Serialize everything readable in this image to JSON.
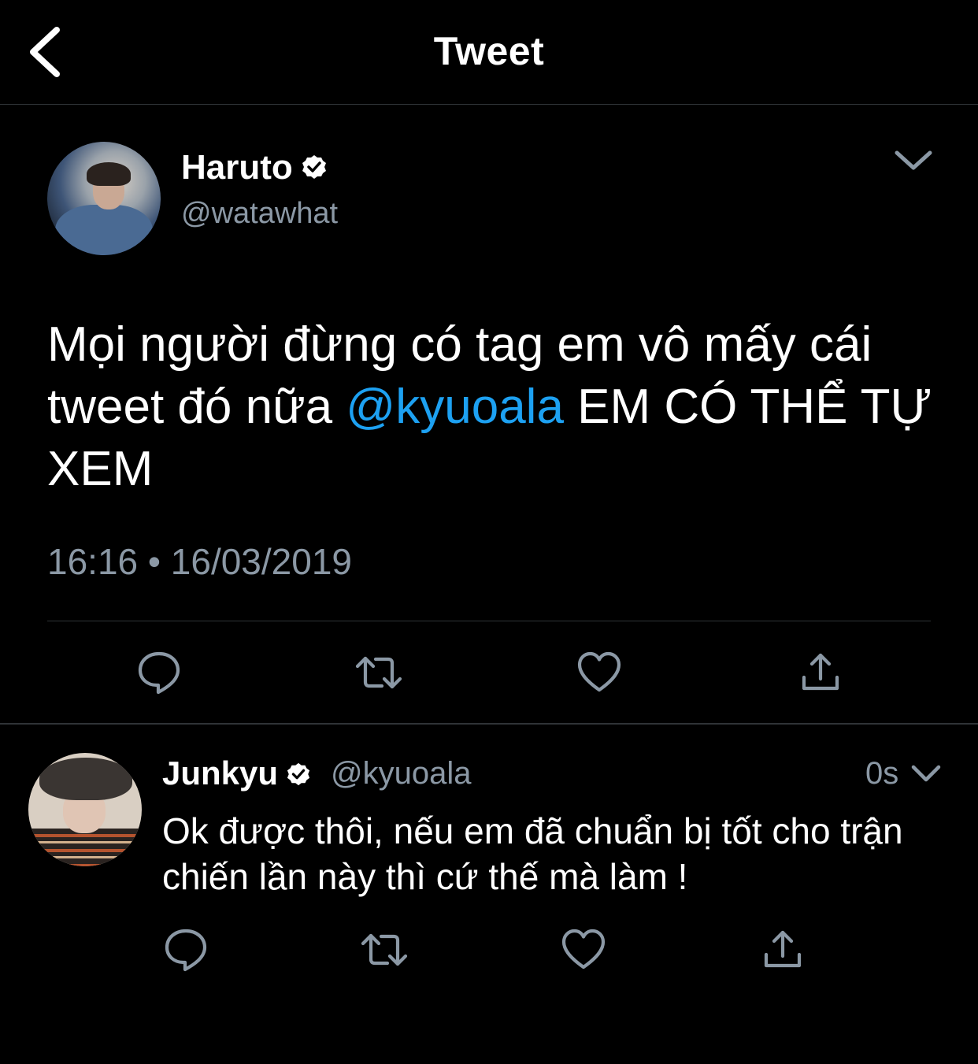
{
  "header": {
    "title": "Tweet"
  },
  "tweet": {
    "author_name": "Haruto",
    "author_handle": "@watawhat",
    "text_before": "Mọi người đừng có tag em vô mấy cái tweet đó nữa ",
    "mention": "@kyuoala",
    "text_after": " EM CÓ THỂ TỰ XEM",
    "timestamp": "16:16 • 16/03/2019"
  },
  "reply": {
    "author_name": "Junkyu",
    "author_handle": "@kyuoala",
    "time": "0s",
    "text": "Ok được thôi, nếu em đã chuẩn bị tốt cho trận chiến lần này thì cứ thế mà làm !"
  },
  "icons": {
    "back": "chevron-left-icon",
    "verified": "verified-badge-icon",
    "more": "chevron-down-icon",
    "reply": "reply-icon",
    "retweet": "retweet-icon",
    "like": "heart-icon",
    "share": "share-icon"
  },
  "colors": {
    "background": "#000000",
    "text": "#ffffff",
    "secondary": "#8b98a5",
    "link": "#1da1f2",
    "divider": "#2f3336"
  }
}
